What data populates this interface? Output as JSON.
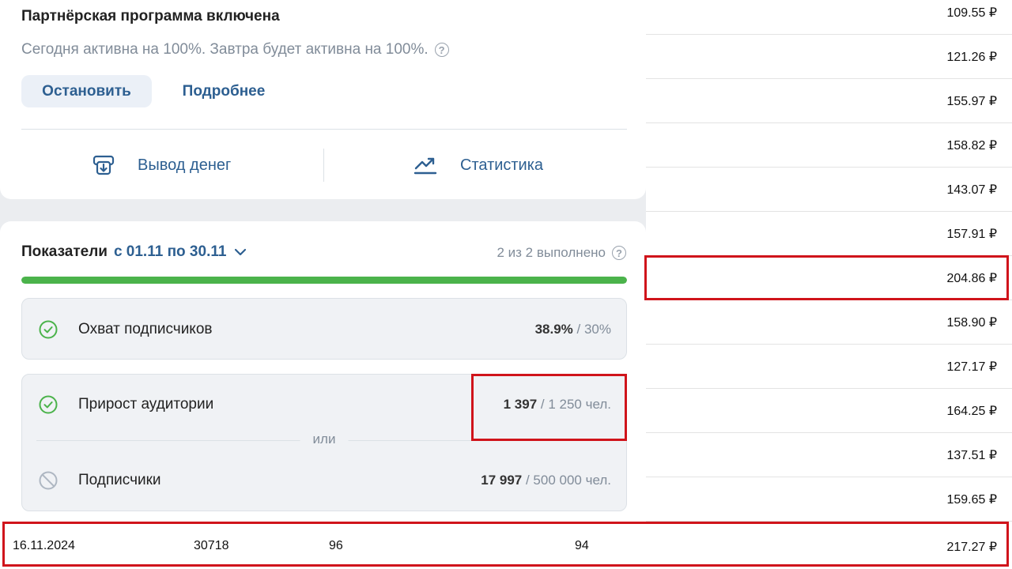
{
  "affiliate": {
    "title": "Партнёрская программа включена",
    "status": "Сегодня активна на 100%. Завтра будет активна на 100%.",
    "help": "?",
    "stop_label": "Остановить",
    "more_label": "Подробнее",
    "withdraw_label": "Вывод денег",
    "stats_label": "Статистика"
  },
  "metrics": {
    "label": "Показатели",
    "period": "с 01.11 по 30.11",
    "completed": "2 из 2 выполнено",
    "progress_fraction": 1.0,
    "or_label": "или",
    "items": [
      {
        "name": "Охват подписчиков",
        "current": "38.9%",
        "goal": "30%",
        "status": "done"
      },
      {
        "name": "Прирост аудитории",
        "current": "1 397",
        "goal": "1 250 чел.",
        "status": "done"
      },
      {
        "name": "Подписчики",
        "current": "17 997",
        "goal": "500 000 чел.",
        "status": "blocked"
      }
    ]
  },
  "amounts": [
    "109.55 ₽",
    "121.26 ₽",
    "155.97 ₽",
    "158.82 ₽",
    "143.07 ₽",
    "157.91 ₽",
    "204.86 ₽",
    "158.90 ₽",
    "127.17 ₽",
    "164.25 ₽",
    "137.51 ₽",
    "159.65 ₽"
  ],
  "bottom_row": {
    "date": "16.11.2024",
    "col2": "30718",
    "col3": "96",
    "col4": "94",
    "amount": "217.27 ₽"
  },
  "colors": {
    "accent": "#2d5f91",
    "success": "#4bb34b",
    "highlight": "#d0141b",
    "muted": "#818c99"
  },
  "icons": [
    "help-icon",
    "withdraw-icon",
    "trend-chart-icon",
    "chevron-down-icon",
    "check-circle-icon",
    "blocked-icon"
  ]
}
